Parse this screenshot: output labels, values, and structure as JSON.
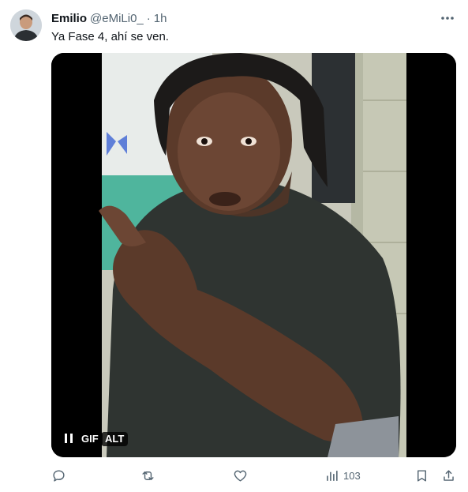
{
  "tweet": {
    "author_name": "Emilio",
    "handle": "@eMiLi0_",
    "separator": "·",
    "time": "1h",
    "text": "Ya Fase 4, ahí se ven."
  },
  "media": {
    "type_label": "GIF",
    "alt_label": "ALT",
    "playback_state": "playing"
  },
  "actions": {
    "views_count": "103"
  },
  "icons": {
    "avatar": "avatar-photo",
    "more": "more-horizontal-icon",
    "pause": "pause-icon",
    "reply": "reply-icon",
    "retweet": "retweet-icon",
    "like": "heart-icon",
    "views": "analytics-bar-icon",
    "bookmark": "bookmark-icon",
    "share": "share-icon"
  },
  "colors": {
    "text_primary": "#0f1419",
    "text_secondary": "#536471"
  }
}
